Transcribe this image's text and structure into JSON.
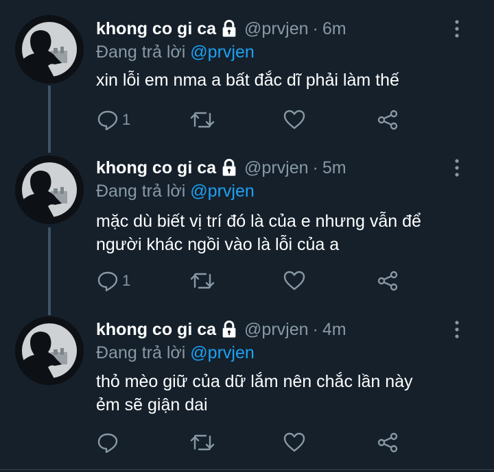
{
  "colors": {
    "background": "#15202b",
    "secondary_text": "#8899a6",
    "link": "#1da1f2",
    "thread_line": "#3d5466"
  },
  "tweets": [
    {
      "name": "khong co gi ca",
      "lock_icon": "lock-icon",
      "handle": "@prvjen",
      "separator": "·",
      "time": "6m",
      "replying_prefix": "Đang trả lời",
      "replying_mention": "@prvjen",
      "text": "xin lỗi em nma a bất đắc dĩ phải làm thế",
      "reply_count": "1"
    },
    {
      "name": "khong co gi ca",
      "lock_icon": "lock-icon",
      "handle": "@prvjen",
      "separator": "·",
      "time": "5m",
      "replying_prefix": "Đang trả lời",
      "replying_mention": "@prvjen",
      "text_line1": "mặc dù biết vị trí đó là của e nhưng vẫn để",
      "text_line2": "người khác ngồi vào là lỗi của a",
      "reply_count": "1"
    },
    {
      "name": "khong co gi ca",
      "lock_icon": "lock-icon",
      "handle": "@prvjen",
      "separator": "·",
      "time": "4m",
      "replying_prefix": "Đang trả lời",
      "replying_mention": "@prvjen",
      "text_line1": "thỏ mèo giữ của dữ lắm nên chắc lần này",
      "text_line2": "ẻm sẽ giận dai",
      "reply_count": ""
    }
  ]
}
